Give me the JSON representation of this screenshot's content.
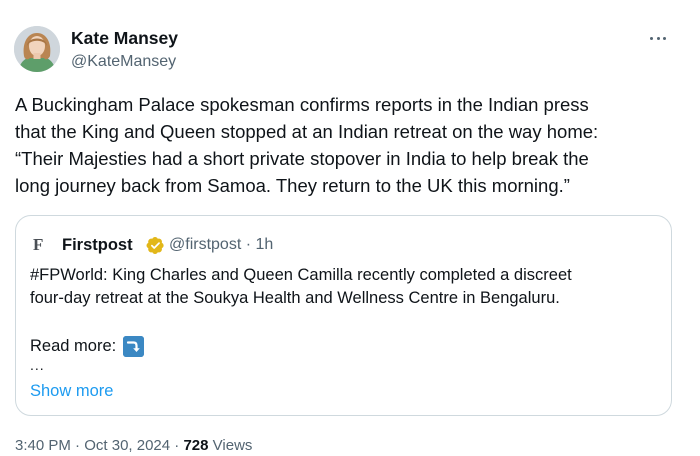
{
  "author": {
    "name": "Kate Mansey",
    "handle": "@KateMansey"
  },
  "more_menu_icon": "more-horizontal-icon",
  "tweet": {
    "lines": [
      "A Buckingham Palace spokesman confirms reports in the Indian press",
      "that the King and Queen stopped at an Indian retreat on the way home:",
      "“Their Majesties had a short private stopover in India to help break the",
      "long journey back from Samoa. They return to the UK this morning.”"
    ]
  },
  "quoted": {
    "logo_letter": "F",
    "name": "Firstpost",
    "badge": "verified-gold-icon",
    "handle": "@firstpost",
    "separator": "·",
    "time": "1h",
    "lines": [
      "#FPWorld: King Charles and Queen Camilla recently completed a discreet",
      "four-day retreat at the Soukya Health and Wellness Centre in Bengaluru."
    ],
    "read_more": "Read more:",
    "read_more_icon": "right-arrow-curving-down-emoji",
    "ellipsis": "...",
    "show_more": "Show more"
  },
  "footer": {
    "time": "3:40 PM",
    "separator": "·",
    "date": "Oct 30, 2024",
    "views_count": "728",
    "views_label": "Views"
  },
  "colors": {
    "text": "#0f1419",
    "secondary": "#536471",
    "link": "#1d9bf0",
    "border": "#cfd9de",
    "verified_gold": "#e2b719"
  }
}
